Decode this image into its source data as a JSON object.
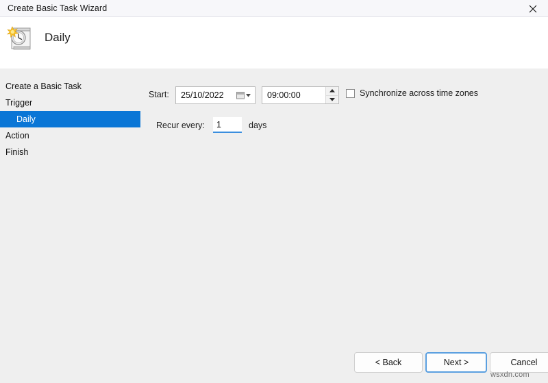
{
  "titlebar": {
    "title": "Create Basic Task Wizard",
    "close_icon": "close-icon"
  },
  "header": {
    "icon": "task-schedule-clock-icon",
    "title": "Daily"
  },
  "sidebar": {
    "items": [
      {
        "label": "Create a Basic Task",
        "selected": false,
        "indent": false
      },
      {
        "label": "Trigger",
        "selected": false,
        "indent": false
      },
      {
        "label": "Daily",
        "selected": true,
        "indent": true
      },
      {
        "label": "Action",
        "selected": false,
        "indent": false
      },
      {
        "label": "Finish",
        "selected": false,
        "indent": false
      }
    ],
    "selected_bg": "#0a76d6"
  },
  "form": {
    "start_label": "Start:",
    "start_date": "25/10/2022",
    "start_date_icon": "calendar-dropdown-icon",
    "start_time": "09:00:00",
    "time_spinner_icon": "spinner-up-down-icon",
    "sync_checkbox_checked": false,
    "sync_label": "Synchronize across time zones",
    "recur_label": "Recur every:",
    "recur_value": "1",
    "days_label": "days",
    "focus_color": "#3b8ede"
  },
  "footer": {
    "back_label": "< Back",
    "next_label": "Next >",
    "cancel_label": "Cancel"
  },
  "watermark": {
    "text": "wsxdn.com"
  }
}
